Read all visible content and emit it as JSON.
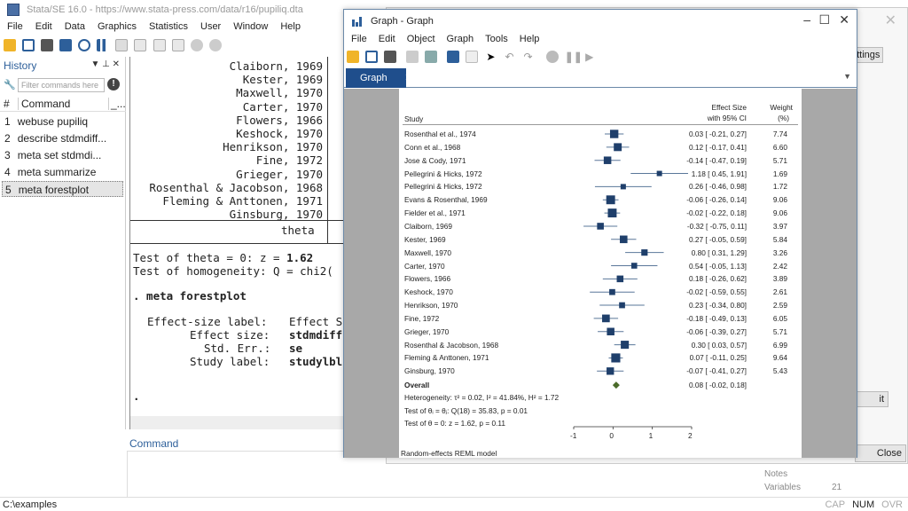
{
  "app": {
    "title": "Stata/SE 16.0 - https://www.stata-press.com/data/r16/pupiliq.dta",
    "menu": [
      "File",
      "Edit",
      "Data",
      "Graphics",
      "Statistics",
      "User",
      "Window",
      "Help"
    ]
  },
  "history": {
    "title": "History",
    "filter_placeholder": "Filter commands here",
    "col_num": "#",
    "col_command": "Command",
    "col_extra": "_...",
    "items": [
      {
        "n": "1",
        "cmd": "webuse pupiliq"
      },
      {
        "n": "2",
        "cmd": "describe stdmdiff..."
      },
      {
        "n": "3",
        "cmd": "meta set stdmdi..."
      },
      {
        "n": "4",
        "cmd": "meta summarize"
      },
      {
        "n": "5",
        "cmd": "meta forestplot"
      }
    ],
    "selected_index": 4
  },
  "results": {
    "study_lines": [
      "Claiborn, 1969",
      "Kester, 1969",
      "Maxwell, 1970",
      "Carter, 1970",
      "Flowers, 1966",
      "Keshock, 1970",
      "Henrikson, 1970",
      "Fine, 1972",
      "Grieger, 1970",
      "Rosenthal & Jacobson, 1968",
      "Fleming & Anttonen, 1971",
      "Ginsburg, 1970"
    ],
    "theta": "theta",
    "test_theta": "Test of theta = 0: z = ",
    "test_theta_val": "1.62",
    "test_homog": "Test of homogeneity: Q = chi2(",
    "cmd_line": ". meta forestplot",
    "es_label_k": "Effect-size label:",
    "es_label_v": "Effect S",
    "es_k": "Effect size:",
    "es_v": "stdmdiff",
    "se_k": "Std. Err.:",
    "se_v": "se",
    "sl_k": "Study label:",
    "sl_v": "studylbl",
    "prompt": "."
  },
  "command": {
    "label": "Command"
  },
  "status": {
    "path": "C:\\examples",
    "cap": "CAP",
    "num": "NUM",
    "ovr": "OVR"
  },
  "dialog": {
    "settings": "ettings",
    "edit": "it",
    "close": "Close"
  },
  "properties": {
    "notes": "Notes",
    "variables": "Variables",
    "variables_val": "21"
  },
  "graph_window": {
    "title": "Graph - Graph",
    "menu": [
      "File",
      "Edit",
      "Object",
      "Graph",
      "Tools",
      "Help"
    ],
    "tab": "Graph"
  },
  "chart_data": {
    "type": "forest",
    "header": {
      "study": "Study",
      "es1": "Effect Size",
      "es2": "with 95% CI",
      "w1": "Weight",
      "w2": "(%)"
    },
    "studies": [
      {
        "name": "Rosenthal et al., 1974",
        "es": 0.03,
        "lo": -0.21,
        "hi": 0.27,
        "w": 7.74
      },
      {
        "name": "Conn et al., 1968",
        "es": 0.12,
        "lo": -0.17,
        "hi": 0.41,
        "w": 6.6
      },
      {
        "name": "Jose & Cody, 1971",
        "es": -0.14,
        "lo": -0.47,
        "hi": 0.19,
        "w": 5.71
      },
      {
        "name": "Pellegrini & Hicks, 1972",
        "es": 1.18,
        "lo": 0.45,
        "hi": 1.91,
        "w": 1.69
      },
      {
        "name": "Pellegrini & Hicks, 1972",
        "es": 0.26,
        "lo": -0.46,
        "hi": 0.98,
        "w": 1.72
      },
      {
        "name": "Evans & Rosenthal, 1969",
        "es": -0.06,
        "lo": -0.26,
        "hi": 0.14,
        "w": 9.06
      },
      {
        "name": "Fielder et al., 1971",
        "es": -0.02,
        "lo": -0.22,
        "hi": 0.18,
        "w": 9.06
      },
      {
        "name": "Claiborn, 1969",
        "es": -0.32,
        "lo": -0.75,
        "hi": 0.11,
        "w": 3.97
      },
      {
        "name": "Kester, 1969",
        "es": 0.27,
        "lo": -0.05,
        "hi": 0.59,
        "w": 5.84
      },
      {
        "name": "Maxwell, 1970",
        "es": 0.8,
        "lo": 0.31,
        "hi": 1.29,
        "w": 3.26
      },
      {
        "name": "Carter, 1970",
        "es": 0.54,
        "lo": -0.05,
        "hi": 1.13,
        "w": 2.42
      },
      {
        "name": "Flowers, 1966",
        "es": 0.18,
        "lo": -0.26,
        "hi": 0.62,
        "w": 3.89
      },
      {
        "name": "Keshock, 1970",
        "es": -0.02,
        "lo": -0.59,
        "hi": 0.55,
        "w": 2.61
      },
      {
        "name": "Henrikson, 1970",
        "es": 0.23,
        "lo": -0.34,
        "hi": 0.8,
        "w": 2.59
      },
      {
        "name": "Fine, 1972",
        "es": -0.18,
        "lo": -0.49,
        "hi": 0.13,
        "w": 6.05
      },
      {
        "name": "Grieger, 1970",
        "es": -0.06,
        "lo": -0.39,
        "hi": 0.27,
        "w": 5.71
      },
      {
        "name": "Rosenthal & Jacobson, 1968",
        "es": 0.3,
        "lo": 0.03,
        "hi": 0.57,
        "w": 6.99
      },
      {
        "name": "Fleming & Anttonen, 1971",
        "es": 0.07,
        "lo": -0.11,
        "hi": 0.25,
        "w": 9.64
      },
      {
        "name": "Ginsburg, 1970",
        "es": -0.07,
        "lo": -0.41,
        "hi": 0.27,
        "w": 5.43
      }
    ],
    "overall": {
      "name": "Overall",
      "es": 0.08,
      "lo": -0.02,
      "hi": 0.18
    },
    "notes": [
      "Heterogeneity: τ² = 0.02, I² = 41.84%, H² = 1.72",
      "Test of θᵢ = θⱼ: Q(18) = 35.83, p = 0.01",
      "Test of θ = 0: z = 1.62, p = 0.11"
    ],
    "xaxis": {
      "ticks": [
        -1,
        0,
        1,
        2
      ],
      "range": [
        -1,
        2
      ]
    },
    "footer": "Random-effects REML model",
    "marker_color": "#1f3f6b",
    "overall_color": "#4a6b2a"
  }
}
